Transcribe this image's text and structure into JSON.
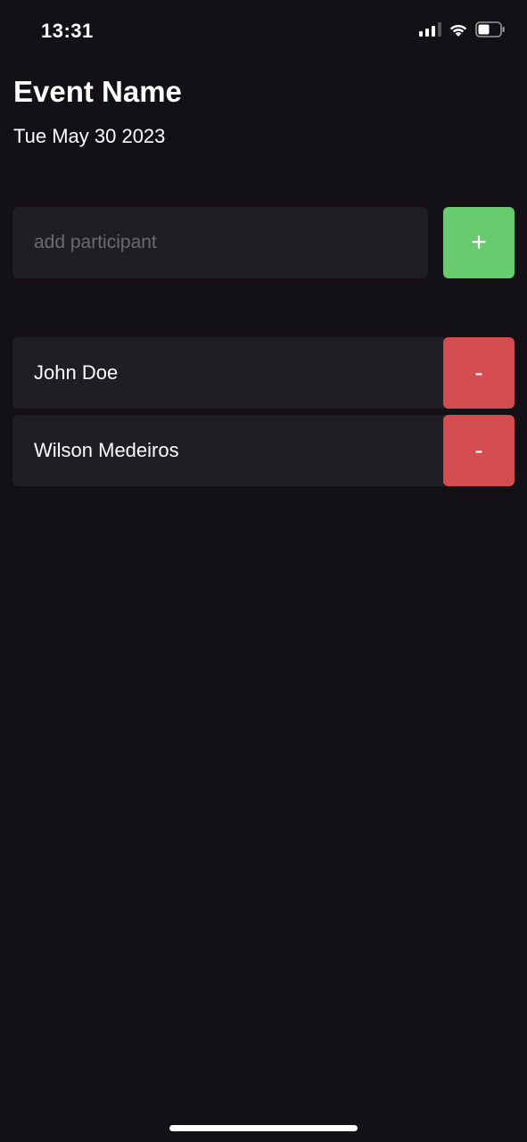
{
  "status_bar": {
    "time": "13:31",
    "icons": [
      "signal-icon",
      "wifi-icon",
      "battery-icon"
    ]
  },
  "event": {
    "title": "Event Name",
    "date": "Tue May 30 2023"
  },
  "add_form": {
    "placeholder": "add participant",
    "value": "",
    "add_label": "+"
  },
  "participants": [
    {
      "name": "John Doe",
      "remove_label": "-"
    },
    {
      "name": "Wilson Medeiros",
      "remove_label": "-"
    }
  ],
  "colors": {
    "background": "#131016",
    "surface": "#1f1e24",
    "add_button": "#66cc6e",
    "remove_button": "#d34c50",
    "placeholder": "#6b6b70"
  }
}
